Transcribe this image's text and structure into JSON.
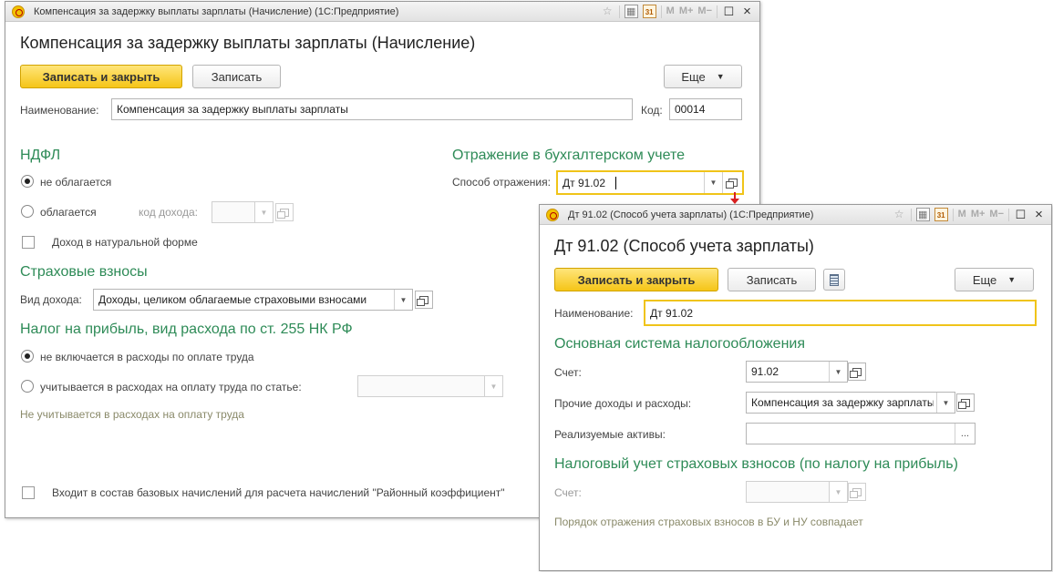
{
  "main": {
    "window_title": "Компенсация за задержку выплаты зарплаты (Начисление)  (1С:Предприятие)",
    "title": "Компенсация за задержку выплаты зарплаты (Начисление)",
    "btn_save_close": "Записать и закрыть",
    "btn_save": "Записать",
    "btn_more": "Еще",
    "name_label": "Наименование:",
    "name_value": "Компенсация за задержку выплаты зарплаты",
    "code_label": "Код:",
    "code_value": "00014",
    "ndfl": {
      "heading": "НДФЛ",
      "opt_not_taxed": "не облагается",
      "opt_taxed": "облагается",
      "income_code_label": "код дохода:",
      "natural_form": "Доход в натуральной форме"
    },
    "accounting": {
      "heading": "Отражение в бухгалтерском учете",
      "method_label": "Способ отражения:",
      "method_value": "Дт 91.02"
    },
    "insurance": {
      "heading": "Страховые взносы",
      "income_type_label": "Вид дохода:",
      "income_type_value": "Доходы, целиком облагаемые страховыми взносами"
    },
    "profit_tax": {
      "heading": "Налог на прибыль, вид расхода по ст. 255 НК РФ",
      "opt_not_included": "не включается в расходы по оплате труда",
      "opt_included": "учитывается в расходах на оплату труда по статье:",
      "note": "Не учитывается в расходах на оплату труда"
    },
    "base_accruals": "Входит в состав базовых начислений для расчета начислений \"Районный коэффициент\""
  },
  "popup": {
    "window_title": "Дт 91.02 (Способ учета зарплаты)  (1С:Предприятие)",
    "title": "Дт 91.02 (Способ учета зарплаты)",
    "btn_save_close": "Записать и закрыть",
    "btn_save": "Записать",
    "btn_more": "Еще",
    "name_label": "Наименование:",
    "name_value": "Дт 91.02",
    "main_tax": {
      "heading": "Основная система налогообложения",
      "account_label": "Счет:",
      "account_value": "91.02",
      "other_label": "Прочие доходы и расходы:",
      "other_value": "Компенсация за задержку зарплаты",
      "assets_label": "Реализуемые активы:",
      "assets_value": ""
    },
    "insurance_tax": {
      "heading": "Налоговый учет страховых взносов (по налогу на прибыль)",
      "account_label": "Счет:",
      "account_value": "",
      "note": "Порядок отражения страховых взносов в БУ и НУ совпадает"
    }
  },
  "titlebar_icons": {
    "m": "M",
    "mplus": "M+",
    "mminus": "M−",
    "calendar": "31"
  },
  "colors": {
    "section_green": "#2e8b57",
    "primary_yellow": "#f5c518",
    "focus_border": "#f0c419",
    "arrow_red": "#d82020"
  }
}
